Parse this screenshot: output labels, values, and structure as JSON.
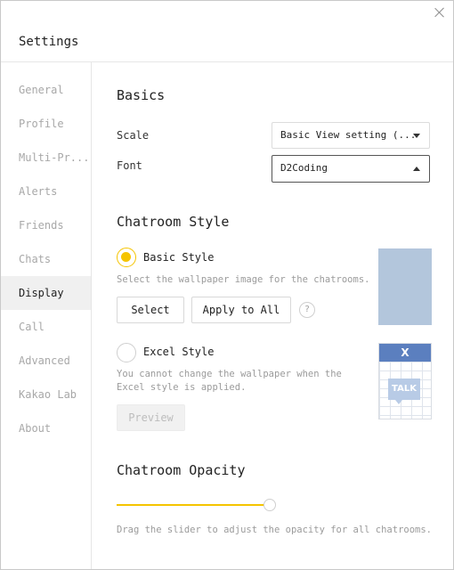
{
  "window": {
    "title": "Settings"
  },
  "sidebar": {
    "items": [
      {
        "label": "General"
      },
      {
        "label": "Profile"
      },
      {
        "label": "Multi-Pr..."
      },
      {
        "label": "Alerts"
      },
      {
        "label": "Friends"
      },
      {
        "label": "Chats"
      },
      {
        "label": "Display",
        "active": true
      },
      {
        "label": "Call"
      },
      {
        "label": "Advanced"
      },
      {
        "label": "Kakao Lab"
      },
      {
        "label": "About"
      }
    ]
  },
  "basics": {
    "heading": "Basics",
    "scale_label": "Scale",
    "scale_value": "Basic View setting (...",
    "font_label": "Font",
    "font_value": "D2Coding"
  },
  "chatroom_style": {
    "heading": "Chatroom Style",
    "basic": {
      "label": "Basic Style",
      "selected": true,
      "description": "Select the wallpaper image for the chatrooms.",
      "select_button": "Select",
      "apply_all_button": "Apply to All",
      "help": "?"
    },
    "excel": {
      "label": "Excel Style",
      "selected": false,
      "description": "You cannot change the wallpaper when the Excel style is applied.",
      "preview_button": "Preview",
      "preview_header": "X",
      "preview_badge": "TALK"
    }
  },
  "opacity": {
    "heading": "Chatroom Opacity",
    "slider_value": 1.0,
    "description": "Drag the slider to adjust the opacity for all chatrooms."
  },
  "colors": {
    "accent": "#f5c400",
    "wallpaper": "#b3c6dc",
    "excel_header": "#5b7fbf"
  }
}
